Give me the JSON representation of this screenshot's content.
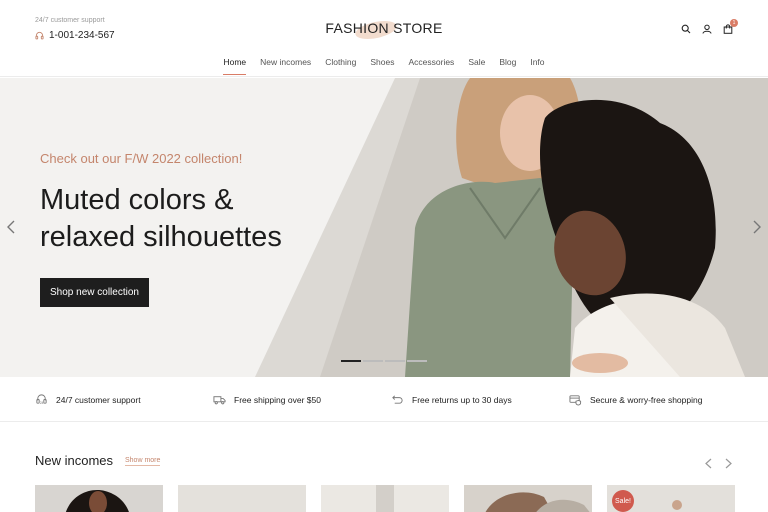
{
  "header": {
    "support_label": "24/7 customer support",
    "support_phone": "1-001-234-567",
    "logo": "FASHION STORE",
    "cart_count": "1",
    "icons": [
      "search-icon",
      "user-icon",
      "cart-icon"
    ]
  },
  "nav": {
    "items": [
      "Home",
      "New incomes",
      "Clothing",
      "Shoes",
      "Accessories",
      "Sale",
      "Blog",
      "Info"
    ],
    "active": "Home"
  },
  "hero": {
    "eyebrow": "Check out our F/W 2022 collection!",
    "title_line1": "Muted colors &",
    "title_line2": "relaxed silhouettes",
    "button": "Shop new collection",
    "slide_count": 4,
    "active_slide": 1
  },
  "features": {
    "items": [
      {
        "icon": "support-icon",
        "label": "24/7 customer support"
      },
      {
        "icon": "truck-icon",
        "label": "Free shipping over $50"
      },
      {
        "icon": "return-icon",
        "label": "Free returns up to 30 days"
      },
      {
        "icon": "secure-icon",
        "label": "Secure & worry-free shopping"
      }
    ]
  },
  "new_incomes": {
    "title": "New incomes",
    "show_more": "Show more",
    "sale_badge": "Sale!"
  },
  "colors": {
    "accent": "#d97c66",
    "eyebrow": "#c4856c",
    "button_bg": "#1e1e1e",
    "sale": "#d05a4e"
  }
}
